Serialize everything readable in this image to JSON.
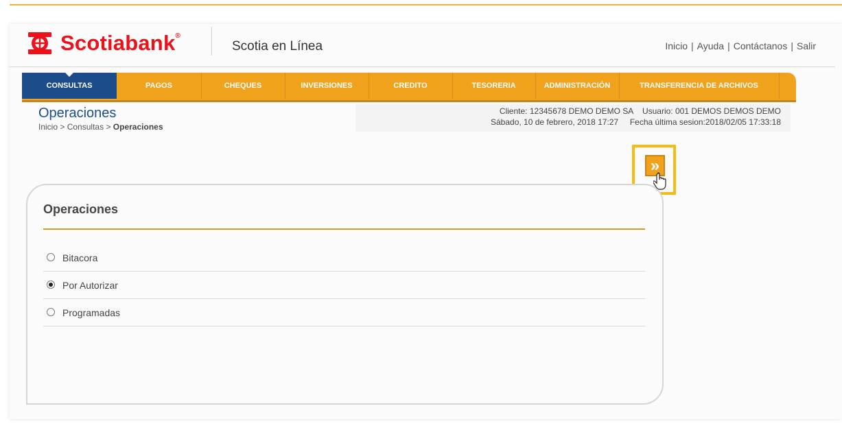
{
  "header": {
    "brand": "Scotiabank",
    "brand_mark": "®",
    "app_name": "Scotia en Línea",
    "links": [
      "Inicio",
      "Ayuda",
      "Contáctanos",
      "Salir"
    ],
    "link_separator": "|"
  },
  "nav": {
    "items": [
      {
        "label": "CONSULTAS",
        "active": true
      },
      {
        "label": "PAGOS"
      },
      {
        "label": "CHEQUES"
      },
      {
        "label": "INVERSIONES"
      },
      {
        "label": "CREDITO"
      },
      {
        "label": "TESORERIA"
      },
      {
        "label": "ADMINISTRACIÓN"
      },
      {
        "label": "TRANSFERENCIA DE ARCHIVOS"
      }
    ]
  },
  "page": {
    "title": "Operaciones",
    "breadcrumb": {
      "items": [
        "Inicio",
        "Consultas"
      ],
      "separator": ">",
      "current": "Operaciones"
    }
  },
  "session": {
    "cliente_label": "Cliente:",
    "cliente_value": "12345678 DEMO DEMO SA",
    "usuario_label": "Usuario:",
    "usuario_value": "001 DEMOS DEMOS DEMO",
    "date": "Sábado, 10 de febrero, 2018 17:27",
    "last_session_label": "Fecha última sesion:",
    "last_session_value": "2018/02/05 17:33:18"
  },
  "expand_button": {
    "icon": "double-chevron-right-icon",
    "glyph": "»"
  },
  "panel": {
    "title": "Operaciones",
    "options": [
      {
        "label": "Bitacora",
        "checked": false
      },
      {
        "label": "Por Autorizar",
        "checked": true
      },
      {
        "label": "Programadas",
        "checked": false
      }
    ]
  },
  "colors": {
    "brand_red": "#ec111a",
    "nav_orange": "#f0a21c",
    "nav_active": "#1c4d8a",
    "highlight": "#f5bc15",
    "title_blue": "#1a4d8a"
  }
}
